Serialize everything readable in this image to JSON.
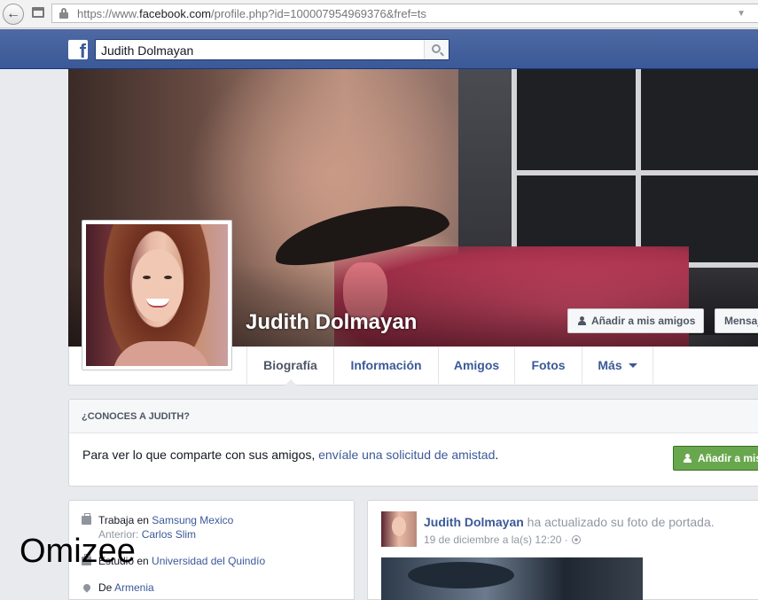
{
  "browser": {
    "url_prefix": "https://www.",
    "url_domain": "facebook.com",
    "url_suffix": "/profile.php?id=100007954969376&fref=ts"
  },
  "topbar": {
    "logo": "f",
    "search_value": "Judith Dolmayan"
  },
  "profile": {
    "name": "Judith Dolmayan",
    "add_friend_label": "Añadir a mis amigos",
    "message_label": "Mensaje"
  },
  "tabs": [
    {
      "label": "Biografía"
    },
    {
      "label": "Información"
    },
    {
      "label": "Amigos"
    },
    {
      "label": "Fotos"
    },
    {
      "label": "Más"
    }
  ],
  "know_card": {
    "title": "¿CONOCES A JUDITH?",
    "text": "Para ver lo que comparte con sus amigos, ",
    "link": "envíale una solicitud de amistad",
    "text_end": ".",
    "button": "Añadir a mis amigos"
  },
  "intro": {
    "work_prefix": "Trabaja en ",
    "work_place": "Samsung Mexico",
    "previous_prefix": "Anterior: ",
    "previous_place": "Carlos Slim",
    "study_prefix": "Estudió en ",
    "study_place": "Universidad del Quindío",
    "from_prefix": "De ",
    "from_place": "Armenia"
  },
  "post": {
    "author": "Judith Dolmayan",
    "action": " ha actualizado su foto de portada.",
    "time": "19 de diciembre a la(s) 12:20 ·"
  },
  "watermark": "Omizee",
  "colors": {
    "fb_blue": "#3b5998",
    "green_button": "#69a74e",
    "page_bg": "#e9eaed"
  }
}
